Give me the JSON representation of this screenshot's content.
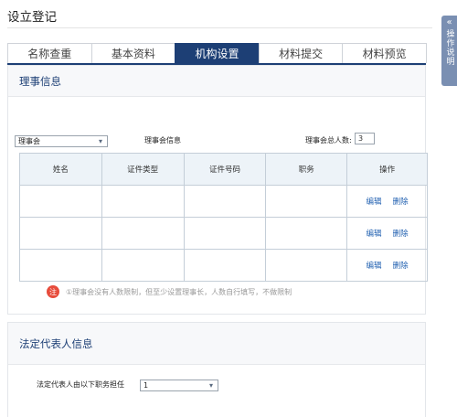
{
  "page": {
    "title": "设立登记"
  },
  "tabs": [
    {
      "label": "名称查重",
      "active": false
    },
    {
      "label": "基本资料",
      "active": false
    },
    {
      "label": "机构设置",
      "active": true
    },
    {
      "label": "材料提交",
      "active": false
    },
    {
      "label": "材料预览",
      "active": false
    }
  ],
  "side_tab": {
    "icon": "chevron-icon",
    "label": "操作说明"
  },
  "council": {
    "section_title": "理事信息",
    "type_select": {
      "value": "理事会"
    },
    "info_label": "理事会信息",
    "total_label": "理事会总人数:",
    "total_value": "3",
    "columns": [
      "姓名",
      "证件类型",
      "证件号码",
      "职务",
      "操作"
    ],
    "rows": [
      {
        "name": "",
        "id_type": "",
        "id_number": "",
        "position": ""
      },
      {
        "name": "",
        "id_type": "",
        "id_number": "",
        "position": ""
      },
      {
        "name": "",
        "id_type": "",
        "id_number": "",
        "position": ""
      }
    ],
    "actions": {
      "edit": "编辑",
      "delete": "删除"
    },
    "note_badge": "注",
    "note": "①理事会没有人数限制，但至少设置理事长，人数自行填写，不做限制"
  },
  "legal": {
    "section_title": "法定代表人信息",
    "label": "法定代表人由以下职务担任",
    "select_value": "1"
  },
  "colors": {
    "accent": "#1d3f75",
    "link": "#1f5fb0",
    "note": "#e74c3c"
  }
}
